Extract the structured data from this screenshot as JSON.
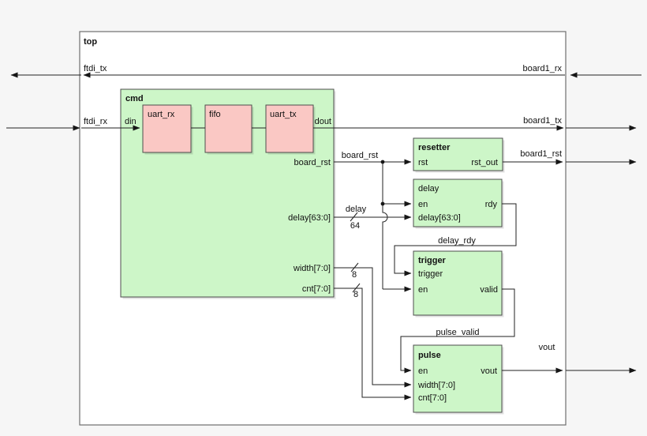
{
  "colors": {
    "page_bg": "#f6f6f6",
    "canvas_bg": "#ffffff",
    "module_green": "#cdf6c8",
    "leaf_pink": "#fac8c4",
    "wire": "#222222",
    "box_border": "#4d4d4d"
  },
  "top": {
    "label": "top"
  },
  "cmd": {
    "label": "cmd",
    "ports": {
      "din": "din",
      "dout": "dout",
      "board_rst": "board_rst",
      "delay": "delay[63:0]",
      "width": "width[7:0]",
      "cnt": "cnt[7:0]"
    },
    "children": {
      "uart_rx": "uart_rx",
      "fifo": "fifo",
      "uart_tx": "uart_tx"
    }
  },
  "resetter": {
    "label": "resetter",
    "ports": {
      "rst": "rst",
      "rst_out": "rst_out"
    }
  },
  "delay": {
    "label": "delay",
    "ports": {
      "en": "en",
      "delay_in": "delay[63:0]",
      "rdy": "rdy"
    }
  },
  "trigger": {
    "label": "trigger",
    "ports": {
      "trigger": "trigger",
      "en": "en",
      "valid": "valid"
    }
  },
  "pulse": {
    "label": "pulse",
    "ports": {
      "en": "en",
      "width": "width[7:0]",
      "cnt": "cnt[7:0]",
      "vout": "vout"
    }
  },
  "nets": {
    "ftdi_tx": "ftdi_tx",
    "ftdi_rx": "ftdi_rx",
    "board1_rx": "board1_rx",
    "board1_tx": "board1_tx",
    "board1_rst": "board1_rst",
    "board_rst": "board_rst",
    "delay": "delay",
    "delay_width": "64",
    "width_bits": "8",
    "cnt_bits": "8",
    "delay_rdy": "delay_rdy",
    "pulse_valid": "pulse_valid",
    "vout": "vout"
  }
}
